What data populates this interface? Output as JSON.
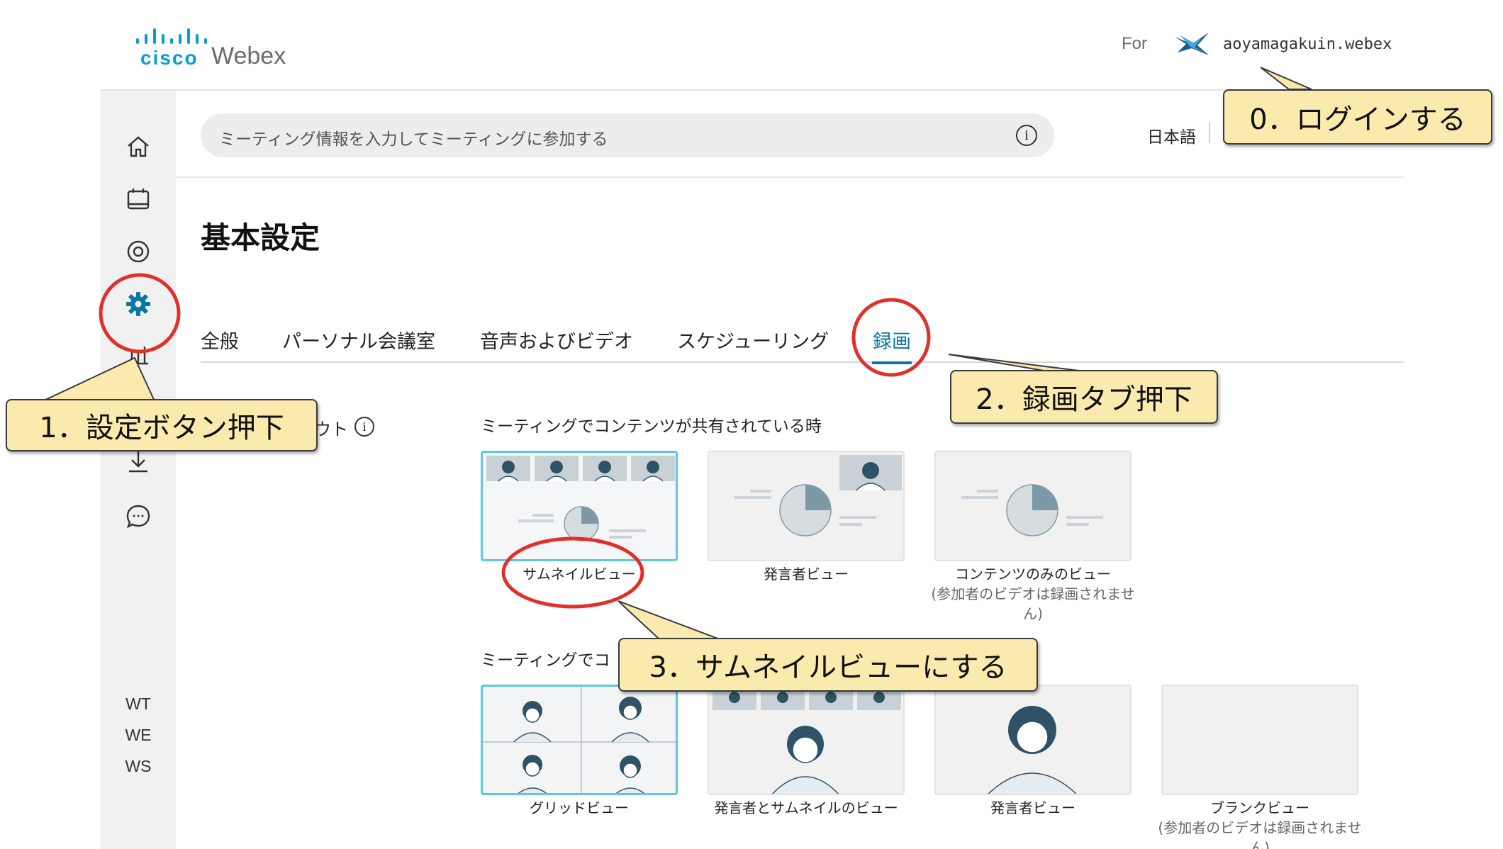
{
  "header": {
    "logo_icon": "cisco-logo",
    "logo_cisco_text": "cisco",
    "logo_product_text": "Webex",
    "for_label": "For",
    "org_icon": "org-logo",
    "org_name": "aoyamagakuin.webex"
  },
  "search": {
    "placeholder": "ミーティング情報を入力してミーティングに参加する",
    "info_icon": "info-icon"
  },
  "language": {
    "label": "日本語"
  },
  "sidebar": {
    "icons": [
      "home-icon",
      "calendar-icon",
      "record-icon",
      "settings-icon",
      "insights-icon",
      "download-icon",
      "chat-icon"
    ],
    "sites": [
      "WT",
      "WE",
      "WS"
    ]
  },
  "page": {
    "title": "基本設定"
  },
  "tabs": [
    {
      "label": "全般"
    },
    {
      "label": "パーソナル会議室"
    },
    {
      "label": "音声およびビデオ"
    },
    {
      "label": "スケジューリング"
    },
    {
      "label": "録画",
      "active": true
    }
  ],
  "recording": {
    "layout_label_partial": "ウト",
    "section_sharing": "ミーティングでコンテンツが共有されている時",
    "section_no_sharing_partial": "ミーティングでコ",
    "sharing_options": [
      {
        "label": "サムネイルビュー",
        "selected": true
      },
      {
        "label": "発言者ビュー"
      },
      {
        "label": "コンテンツのみのビュー",
        "sub": "(参加者のビデオは録画されません)"
      }
    ],
    "no_sharing_options": [
      {
        "label": "グリッドビュー",
        "selected": true
      },
      {
        "label": "発言者とサムネイルのビュー"
      },
      {
        "label": "発言者ビュー"
      },
      {
        "label": "ブランクビュー",
        "sub": "(参加者のビデオは録画されません)"
      }
    ]
  },
  "annotations": {
    "step0": "0．ログインする",
    "step1": "1．設定ボタン押下",
    "step2": "2．録画タブ押下",
    "step3": "3．サムネイルビューにする",
    "callout_color": "#fbeaae",
    "circle_color": "#e0302a"
  },
  "colors": {
    "accent": "#0b76a8",
    "selected_border": "#5fc6e3",
    "cisco_blue": "#049fd9"
  }
}
